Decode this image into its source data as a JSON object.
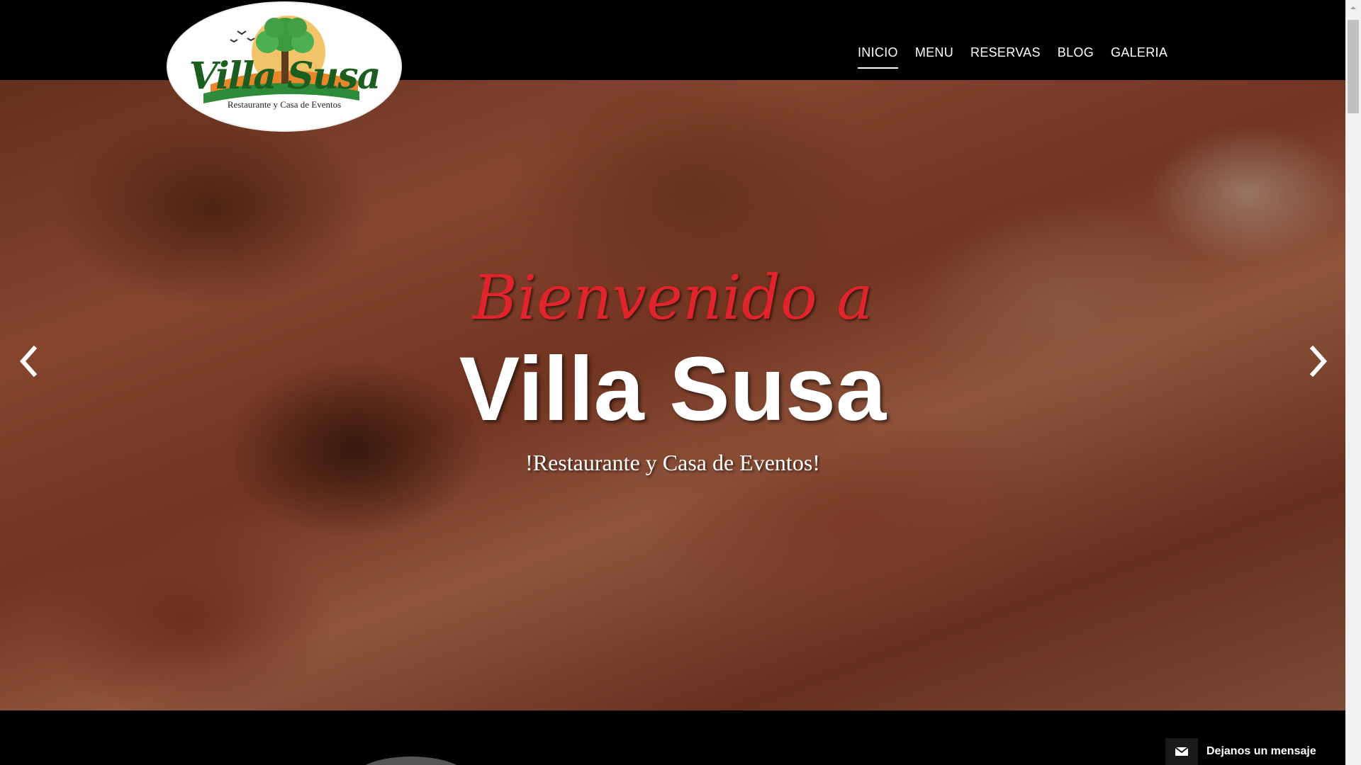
{
  "header": {
    "logo": {
      "name": "Villa Susa",
      "tagline": "Restaurante y Casa de Eventos"
    },
    "nav": [
      {
        "label": "INICIO",
        "active": true
      },
      {
        "label": "MENU",
        "active": false
      },
      {
        "label": "RESERVAS",
        "active": false
      },
      {
        "label": "BLOG",
        "active": false
      },
      {
        "label": "GALERIA",
        "active": false
      }
    ]
  },
  "hero": {
    "script_line": "Bienvenido a",
    "title": "Villa Susa",
    "subtitle": "!Restaurante y Casa de Eventos!",
    "prev_icon": "chevron-left-icon",
    "next_icon": "chevron-right-icon"
  },
  "message_widget": {
    "icon": "envelope-icon",
    "label": "Dejanos un mensaje"
  },
  "colors": {
    "header_bg": "#000000",
    "script_red": "#e0242b",
    "logo_green": "#1b5e20"
  }
}
